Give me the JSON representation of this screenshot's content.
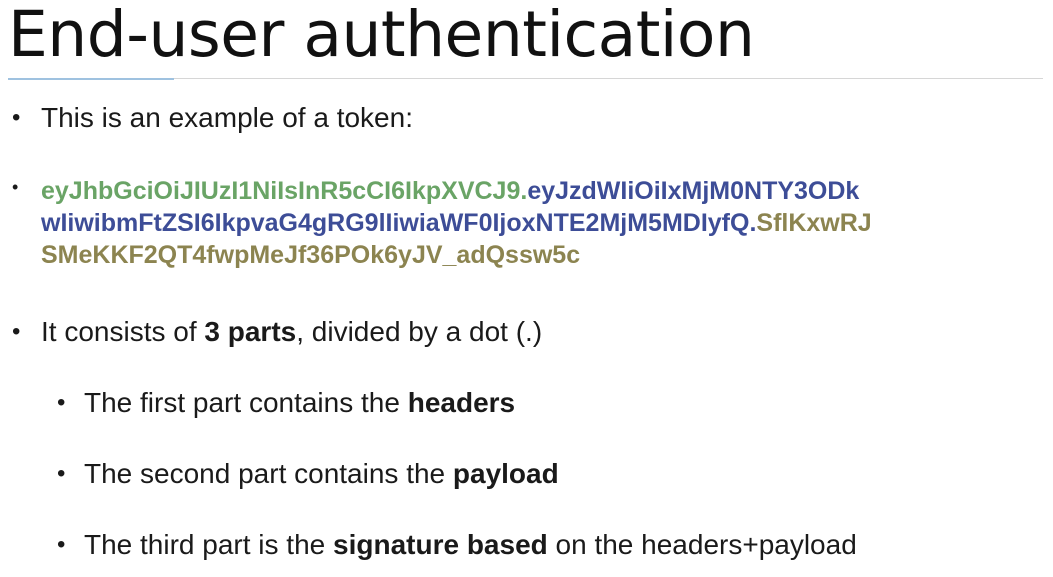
{
  "title": "End-user authentication",
  "bullet_char": "•",
  "bullets": {
    "intro": "This is an example of a token:",
    "parts_prefix": "It consists of ",
    "parts_bold": "3 parts",
    "parts_suffix": ", divided by a dot (.)"
  },
  "token": {
    "line1_header": "eyJhbGciOiJIUzI1NiIsInR5cCI6IkpXVCJ9.",
    "line1_payload": "eyJzdWIiOiIxMjM0NTY3ODk",
    "line2_payload": "wIiwibmFtZSI6IkpvaG4gRG9lIiwiaWF0IjoxNTE2MjM5MDIyfQ.",
    "line2_signature": "SflKxwRJ",
    "line3_signature": "SMeKKF2QT4fwpMeJf36POk6yJV_adQssw5c"
  },
  "sub_bullets": {
    "first_prefix": "The first part contains the ",
    "first_bold": "headers",
    "second_prefix": "The second part contains the ",
    "second_bold": "payload",
    "third_prefix": "The third part is the ",
    "third_bold": "signature based",
    "third_suffix": " on the headers+payload"
  },
  "colors": {
    "token_header": "#6aa466",
    "token_payload": "#3d4d97",
    "token_signature": "#8c8450",
    "title_accent_rule": "#9fc2e0"
  }
}
